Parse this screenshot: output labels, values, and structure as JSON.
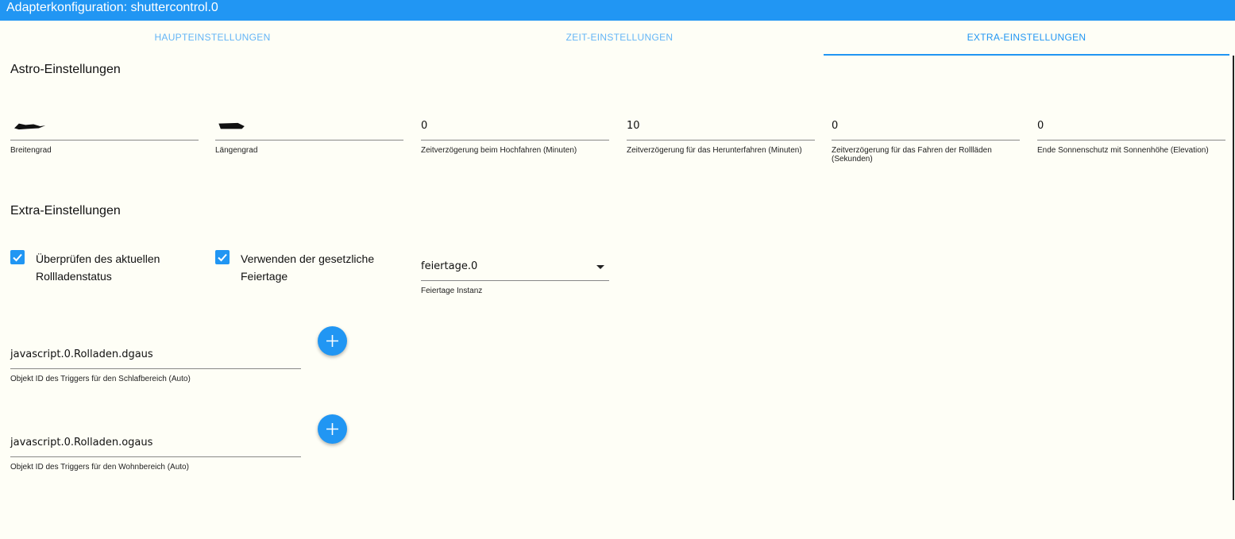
{
  "window": {
    "title": "Adapterkonfiguration: shuttercontrol.0"
  },
  "tabs": [
    {
      "label": "HAUPTEINSTELLUNGEN"
    },
    {
      "label": "ZEIT-EINSTELLUNGEN"
    },
    {
      "label": "EXTRA-EINSTELLUNGEN",
      "active": true
    }
  ],
  "astro": {
    "title": "Astro-Einstellungen",
    "fields": [
      {
        "value": "",
        "label": "Breitengrad",
        "redacted": true
      },
      {
        "value": "",
        "label": "Längengrad",
        "redacted": true
      },
      {
        "value": "0",
        "label": "Zeitverzögerung beim Hochfahren (Minuten)"
      },
      {
        "value": "10",
        "label": "Zeitverzögerung für das Herunterfahren (Minuten)"
      },
      {
        "value": "0",
        "label": "Zeitverzögerung für das Fahren der Rollläden (Sekunden)"
      },
      {
        "value": "0",
        "label": "Ende Sonnenschutz mit Sonnenhöhe (Elevation)"
      }
    ]
  },
  "extra": {
    "title": "Extra-Einstellungen",
    "check_status": {
      "label": "Überprüfen des aktuellen Rollladenstatus",
      "checked": true
    },
    "check_holidays": {
      "label": "Verwenden der gesetzliche Feiertage",
      "checked": true
    },
    "holiday_instance": {
      "value": "feiertage.0",
      "label": "Feiertage Instanz"
    },
    "trigger_sleep": {
      "value": "javascript.0.Rolladen.dgaus",
      "label": "Objekt ID des Triggers für den Schlafbereich (Auto)"
    },
    "trigger_living": {
      "value": "javascript.0.Rolladen.ogaus",
      "label": "Objekt ID des Triggers für den Wohnbereich (Auto)"
    }
  },
  "colors": {
    "accent": "#2196f3",
    "tab_inactive": "#64b5f6",
    "background": "#fefef6"
  },
  "icons": [
    "check-icon",
    "plus-icon",
    "dropdown-arrow-icon"
  ]
}
